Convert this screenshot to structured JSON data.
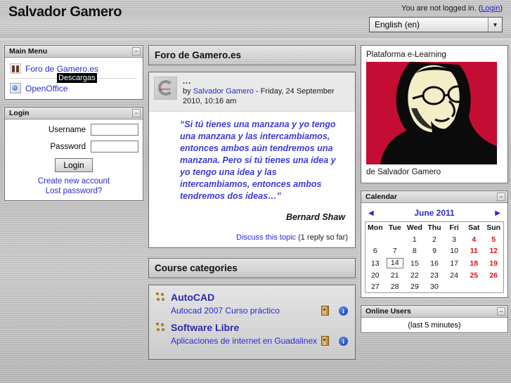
{
  "header": {
    "site_title": "Salvador Gamero",
    "login_info_text": "You are not logged in. (",
    "login_link": "Login",
    "login_info_suffix": ")",
    "language_value": "English (en)",
    "language_arrow": "▼"
  },
  "sidebar_left": {
    "main_menu": {
      "title": "Main Menu",
      "collapse_glyph": "−",
      "items": [
        {
          "label": "Foro de Gamero.es",
          "icon": "forum-icon"
        },
        {
          "label": "OpenOffice",
          "icon": "document-icon"
        }
      ],
      "tooltip": "Descargas"
    },
    "login_block": {
      "title": "Login",
      "collapse_glyph": "−",
      "username_label": "Username",
      "username_value": "",
      "password_label": "Password",
      "password_value": "",
      "login_button": "Login",
      "create_account_link": "Create new account",
      "lost_password_link": "Lost password?"
    }
  },
  "main": {
    "forum_heading": "Foro de Gamero.es",
    "post": {
      "subject": "...",
      "by_prefix": "by ",
      "author": "Salvador Gamero",
      "date": " - Friday, 24 September 2010, 10:16 am",
      "quote": "“Si tú tienes una manzana y yo tengo una manzana y las intercambiamos, entonces ambos aún tendremos una manzana. Pero si tú tienes una idea y yo tengo una idea y las intercambiamos, entonces ambos tendremos dos ideas…”",
      "quote_author": "Bernard Shaw",
      "discuss_link": "Discuss this topic",
      "reply_count": " (1 reply so far)"
    },
    "categories_heading": "Course categories",
    "categories": [
      {
        "name": "AutoCAD",
        "courses": [
          {
            "name": "Autocad 2007 Curso práctico",
            "has_key": true,
            "has_info": true
          }
        ]
      },
      {
        "name": "Software Libre",
        "courses": [
          {
            "name": "Aplicaciones de internet en Guadalinex",
            "has_key": true,
            "has_info": true
          }
        ]
      }
    ]
  },
  "sidebar_right": {
    "logo_block": {
      "caption_top": "Plataforma e-Learning",
      "caption_bottom": "de Salvador Gamero",
      "background_color": "#c40d33",
      "face_color": "#f5edc8"
    },
    "calendar": {
      "title": "Calendar",
      "collapse_glyph": "−",
      "prev_glyph": "◀",
      "next_glyph": "▶",
      "month_label": "June 2011",
      "day_headers": [
        "Mon",
        "Tue",
        "Wed",
        "Thu",
        "Fri",
        "Sat",
        "Sun"
      ],
      "weekend_color": "#dd1111",
      "today": 14,
      "weeks": [
        [
          "",
          "",
          "1",
          "2",
          "3",
          "4",
          "5"
        ],
        [
          "6",
          "7",
          "8",
          "9",
          "10",
          "11",
          "12"
        ],
        [
          "13",
          "14",
          "15",
          "16",
          "17",
          "18",
          "19"
        ],
        [
          "20",
          "21",
          "22",
          "23",
          "24",
          "25",
          "26"
        ],
        [
          "27",
          "28",
          "29",
          "30",
          "",
          "",
          ""
        ]
      ]
    },
    "online_users": {
      "title": "Online Users",
      "collapse_glyph": "−",
      "subtitle": "(last 5 minutes)"
    }
  }
}
